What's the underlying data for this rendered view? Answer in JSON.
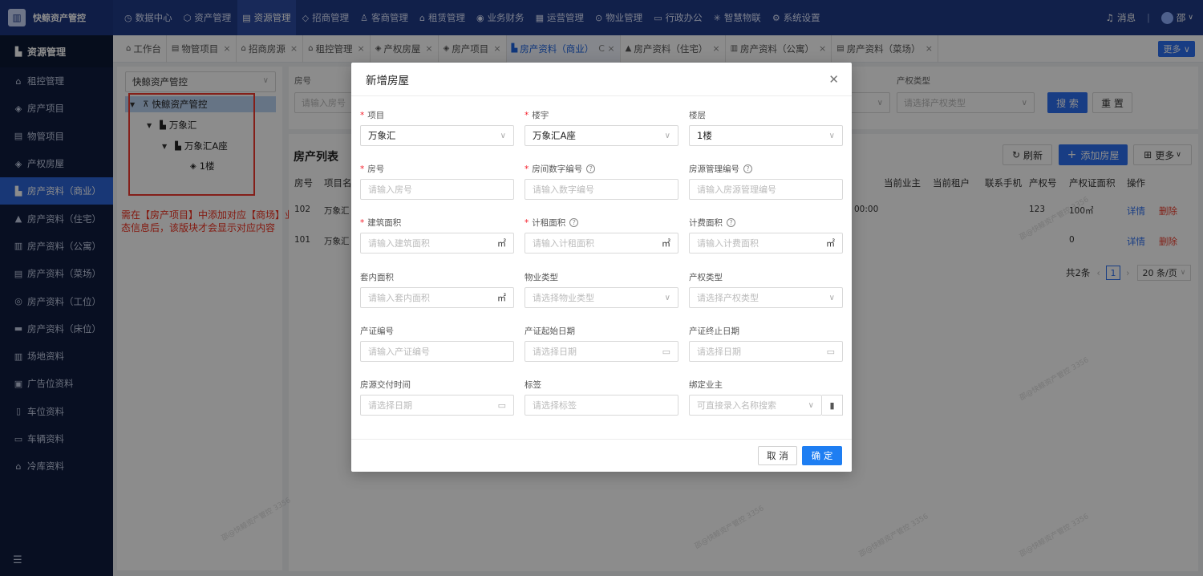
{
  "brand": {
    "name": "快鲸资产管控",
    "logo_icon": "building-icon"
  },
  "topnav": [
    {
      "label": "数据中心",
      "icon": "◷"
    },
    {
      "label": "资产管理",
      "icon": "⬡"
    },
    {
      "label": "资源管理",
      "icon": "▤",
      "active": true
    },
    {
      "label": "招商管理",
      "icon": "◇"
    },
    {
      "label": "客商管理",
      "icon": "♙"
    },
    {
      "label": "租赁管理",
      "icon": "⌂"
    },
    {
      "label": "业务财务",
      "icon": "◉"
    },
    {
      "label": "运营管理",
      "icon": "▦"
    },
    {
      "label": "物业管理",
      "icon": "⊙"
    },
    {
      "label": "行政办公",
      "icon": "▭"
    },
    {
      "label": "智慧物联",
      "icon": "✳"
    },
    {
      "label": "系统设置",
      "icon": "⚙"
    }
  ],
  "top_right": {
    "messages": "消息",
    "user": "邵"
  },
  "sidebar": {
    "header": "资源管理",
    "items": [
      {
        "label": "租控管理",
        "icon": "⌂"
      },
      {
        "label": "房产项目",
        "icon": "◈"
      },
      {
        "label": "物管项目",
        "icon": "▤"
      },
      {
        "label": "产权房屋",
        "icon": "◈"
      },
      {
        "label": "房产资料（商业）",
        "icon": "▙",
        "active": true
      },
      {
        "label": "房产资料（住宅）",
        "icon": "▲"
      },
      {
        "label": "房产资料（公寓）",
        "icon": "▥"
      },
      {
        "label": "房产资料（菜场）",
        "icon": "▤"
      },
      {
        "label": "房产资料（工位）",
        "icon": "◎"
      },
      {
        "label": "房产资料（床位）",
        "icon": "▬"
      },
      {
        "label": "场地资料",
        "icon": "▥"
      },
      {
        "label": "广告位资料",
        "icon": "▣"
      },
      {
        "label": "车位资料",
        "icon": "▯"
      },
      {
        "label": "车辆资料",
        "icon": "▭"
      },
      {
        "label": "冷库资料",
        "icon": "⌂"
      }
    ],
    "footer_icon": "☰"
  },
  "tabs": [
    {
      "label": "工作台",
      "icon": "⌂"
    },
    {
      "label": "物管项目",
      "icon": "▤",
      "close": "×"
    },
    {
      "label": "招商房源",
      "icon": "⌂",
      "close": "×"
    },
    {
      "label": "租控管理",
      "icon": "⌂",
      "close": "×"
    },
    {
      "label": "产权房屋",
      "icon": "◈",
      "close": "×"
    },
    {
      "label": "房产项目",
      "icon": "◈",
      "close": "×"
    },
    {
      "label": "房产资料（商业）",
      "icon": "▙",
      "close": "C ×",
      "active": true
    },
    {
      "label": "房产资料（住宅）",
      "icon": "▲",
      "close": "×"
    },
    {
      "label": "房产资料（公寓）",
      "icon": "▥",
      "close": "×"
    },
    {
      "label": "房产资料（菜场）",
      "icon": "▤",
      "close": "×"
    }
  ],
  "more_btn": "更多 ∨",
  "tree": {
    "select": "快鲸资产管控",
    "nodes": [
      "快鲸资产管控",
      "万象汇",
      "万象汇A座",
      "1楼"
    ]
  },
  "note": "需在【房产项目】中添加对应【商场】业态信息后，该版块才会显示对应内容",
  "search": {
    "label_room": "房号",
    "placeholder_room": "请输入房号",
    "label_property_type": "产权类型",
    "placeholder_property_type": "请选择产权类型",
    "search_btn": "搜 索",
    "reset_btn": "重 置"
  },
  "list": {
    "title": "房产列表",
    "refresh": "刷新",
    "add": "添加房屋",
    "more": "更多",
    "headers": [
      "房号",
      "项目名",
      "当前业主",
      "当前租户",
      "联系手机",
      "产权号",
      "产权证面积",
      "操作"
    ],
    "rows": [
      {
        "room": "102",
        "project": "万象汇",
        "time": "00:00",
        "cert_no": "123",
        "area": "100㎡",
        "detail": "详情",
        "delete": "删除"
      },
      {
        "room": "101",
        "project": "万象汇",
        "time": "",
        "cert_no": "",
        "area": "0",
        "detail": "详情",
        "delete": "删除"
      }
    ],
    "total": "共2条",
    "page": "1",
    "page_size": "20 条/页"
  },
  "watermark": "邵@快鲸资产管控 3356",
  "modal": {
    "title": "新增房屋",
    "fields": {
      "project": {
        "label": "项目",
        "value": "万象汇"
      },
      "building": {
        "label": "楼宇",
        "value": "万象汇A座"
      },
      "floor": {
        "label": "楼层",
        "value": "1楼"
      },
      "room_no": {
        "label": "房号",
        "placeholder": "请输入房号"
      },
      "room_digit": {
        "label": "房间数字编号",
        "placeholder": "请输入数字编号"
      },
      "house_code": {
        "label": "房源管理编号",
        "placeholder": "请输入房源管理编号"
      },
      "build_area": {
        "label": "建筑面积",
        "placeholder": "请输入建筑面积",
        "unit": "㎡"
      },
      "rent_area": {
        "label": "计租面积",
        "placeholder": "请输入计租面积",
        "unit": "㎡"
      },
      "fee_area": {
        "label": "计费面积",
        "placeholder": "请输入计费面积",
        "unit": "㎡"
      },
      "inner_area": {
        "label": "套内面积",
        "placeholder": "请输入套内面积",
        "unit": "㎡"
      },
      "estate_type": {
        "label": "物业类型",
        "placeholder": "请选择物业类型"
      },
      "right_type": {
        "label": "产权类型",
        "placeholder": "请选择产权类型"
      },
      "cert_no": {
        "label": "产证编号",
        "placeholder": "请输入产证编号"
      },
      "cert_start": {
        "label": "产证起始日期",
        "placeholder": "请选择日期"
      },
      "cert_end": {
        "label": "产证终止日期",
        "placeholder": "请选择日期"
      },
      "deliver_time": {
        "label": "房源交付时间",
        "placeholder": "请选择日期"
      },
      "tags": {
        "label": "标签",
        "placeholder": "请选择标签"
      },
      "owner": {
        "label": "绑定业主",
        "placeholder": "可直接录入名称搜索"
      }
    },
    "cancel": "取 消",
    "ok": "确 定"
  }
}
